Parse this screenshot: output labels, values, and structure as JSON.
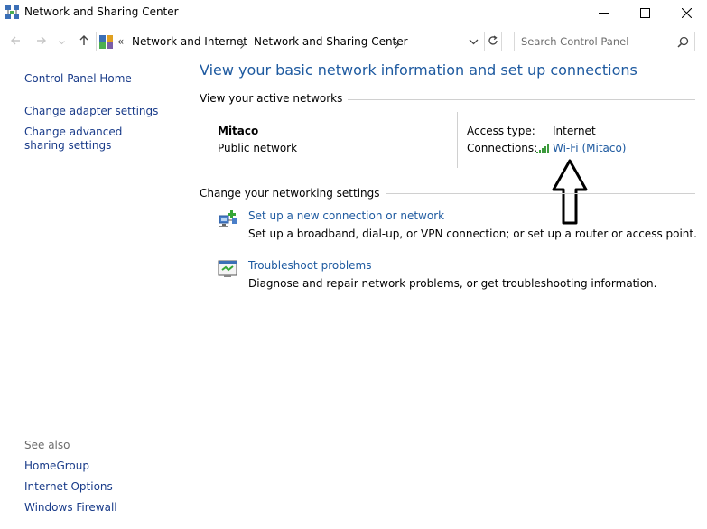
{
  "window": {
    "title": "Network and Sharing Center"
  },
  "address": {
    "overflow": "«",
    "crumbs": [
      "Network and Internet",
      "Network and Sharing Center"
    ]
  },
  "search": {
    "placeholder": "Search Control Panel"
  },
  "left_pane": {
    "home": "Control Panel Home",
    "links": [
      "Change adapter settings",
      "Change advanced sharing settings"
    ],
    "see_also_title": "See also",
    "see_also": [
      "HomeGroup",
      "Internet Options",
      "Windows Firewall"
    ]
  },
  "main": {
    "title": "View your basic network information and set up connections",
    "active_networks": {
      "heading": "View your active networks",
      "network_name": "Mitaco",
      "network_type": "Public network",
      "access_type_label": "Access type:",
      "access_type_value": "Internet",
      "connections_label": "Connections:",
      "connection_name": "Wi-Fi (Mitaco)"
    },
    "settings": {
      "heading": "Change your networking settings",
      "tasks": [
        {
          "title": "Set up a new connection or network",
          "description": "Set up a broadband, dial-up, or VPN connection; or set up a router or access point."
        },
        {
          "title": "Troubleshoot problems",
          "description": "Diagnose and repair network problems, or get troubleshooting information."
        }
      ]
    }
  },
  "colors": {
    "link": "#1e5aa0",
    "left_link": "#1a3c8a",
    "divider": "#d0d0d0",
    "muted": "#6d6d6d"
  }
}
